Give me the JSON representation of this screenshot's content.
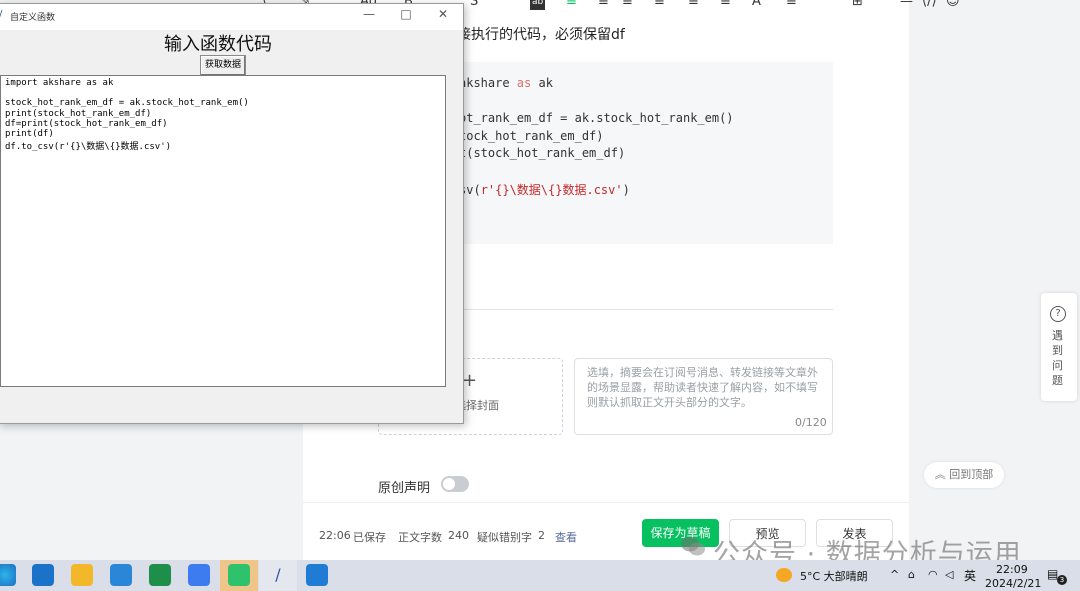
{
  "editor": {
    "toolbar_glyphs": [
      "▾",
      "▾",
      "≡",
      "▾",
      "≡",
      "≡",
      "▾",
      "≡",
      "≡",
      "▾",
      "⊞",
      "”",
      "—",
      "⟨/⟩",
      "☺"
    ],
    "heading_text": "接执行的代码，必须保留df",
    "code_lines": [
      {
        "pre": "akshare ",
        "kw": "as",
        "post": " ak"
      },
      {
        "pre": "",
        "kw": "",
        "post": ""
      },
      {
        "pre": "ot_rank_em_df = ak.stock_hot_rank_em()",
        "kw": "",
        "post": ""
      },
      {
        "pre": "tock_hot_rank_em_df)",
        "kw": "",
        "post": ""
      },
      {
        "pre": "t(stock_hot_rank_em_df)",
        "kw": "",
        "post": ""
      },
      {
        "pre": ")",
        "kw": "",
        "post": ""
      },
      {
        "pre": "sv(",
        "kw": "",
        "str": "r'{}\\数据\\{}数据.csv'",
        "post": ")"
      }
    ],
    "cover_plus": "+",
    "cover_label": "选择封面",
    "summary_placeholder": "选填，摘要会在订阅号消息、转发链接等文章外的场景显露，帮助读者快速了解内容，如不填写则默认抓取正文开头部分的文字。",
    "summary_count": "0/120",
    "original_label": "原创声明",
    "status": {
      "saved_time": "22:06",
      "saved_label": "已保存",
      "word_label": "正文字数",
      "word_count": "240",
      "typo_label": "疑似错别字",
      "typo_count": "2",
      "check_link": "查看"
    },
    "buttons": {
      "save_draft": "保存为草稿",
      "preview": "预览",
      "publish": "发表"
    },
    "back_to_top": "回到顶部",
    "side_panel": {
      "icon": "?",
      "text": "遇到问题"
    },
    "watermark": "公众号 · 数据分析与运用"
  },
  "tkwindow": {
    "title": "自定义函数",
    "heading": "输入函数代码",
    "button": "获取数据",
    "controls": {
      "minimize": "—",
      "maximize": "□",
      "close": "✕"
    },
    "code_lines": [
      "import akshare as ak",
      "",
      "stock_hot_rank_em_df = ak.stock_hot_rank_em()",
      "print(stock_hot_rank_em_df)",
      "df=print(stock_hot_rank_em_df)",
      "print(df)",
      "df.to_csv(r'{}\\数据\\{}数据.csv')"
    ]
  },
  "taskbar": {
    "apps": [
      "edge",
      "mail",
      "file-explorer",
      "store",
      "remote",
      "baidu",
      "wechat",
      "pen",
      "vscode"
    ],
    "weather": "5°C  大部晴朗",
    "ime": "英",
    "time": "22:09",
    "date": "2024/2/21",
    "notification_count": "3"
  },
  "colors": {
    "green": "#07c160",
    "code_keyword": "#d9736a",
    "code_string": "#c62828",
    "taskbar": "#d9dee8"
  }
}
